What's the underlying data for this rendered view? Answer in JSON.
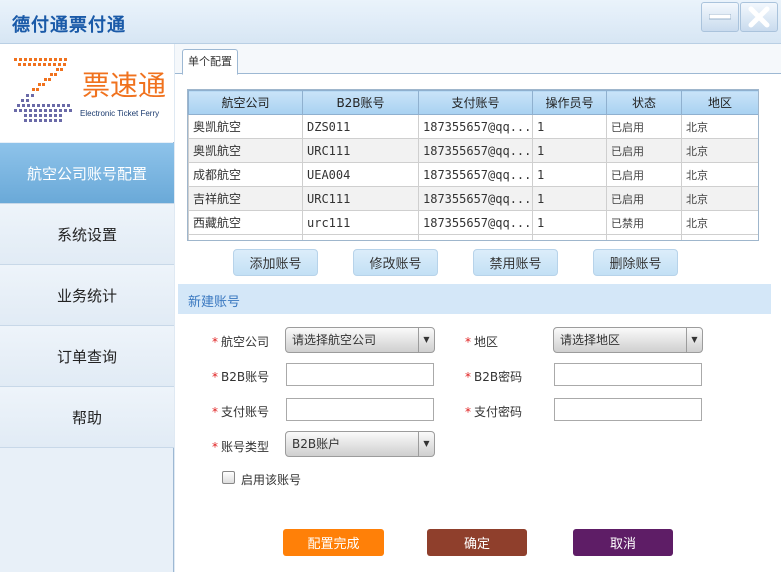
{
  "app": {
    "title": "德付通票付通"
  },
  "logo": {
    "name": "票速通",
    "sub": "Electronic Ticket Ferry"
  },
  "sidebar": {
    "items": [
      {
        "label": "航空公司账号配置",
        "active": true
      },
      {
        "label": "系统设置"
      },
      {
        "label": "业务统计"
      },
      {
        "label": "订单查询"
      },
      {
        "label": "帮助"
      }
    ]
  },
  "tabs": [
    {
      "label": "单个配置"
    }
  ],
  "table": {
    "headers": [
      "航空公司",
      "B2B账号",
      "支付账号",
      "操作员号",
      "状态",
      "地区"
    ],
    "rows": [
      [
        "奥凯航空",
        "DZS011",
        "187355657@qq...",
        "1",
        "已启用",
        "北京"
      ],
      [
        "奥凯航空",
        "URC111",
        "187355657@qq...",
        "1",
        "已启用",
        "北京"
      ],
      [
        "成都航空",
        "UEA004",
        "187355657@qq...",
        "1",
        "已启用",
        "北京"
      ],
      [
        "吉祥航空",
        "URC111",
        "187355657@qq...",
        "1",
        "已启用",
        "北京"
      ],
      [
        "西藏航空",
        "urc111",
        "187355657@qq...",
        "1",
        "已禁用",
        "北京"
      ]
    ]
  },
  "actions": {
    "add": "添加账号",
    "edit": "修改账号",
    "disable": "禁用账号",
    "delete": "删除账号"
  },
  "form": {
    "section_title": "新建账号",
    "airline_label": "航空公司",
    "airline_value": "请选择航空公司",
    "region_label": "地区",
    "region_value": "请选择地区",
    "b2b_account_label": "B2B账号",
    "b2b_password_label": "B2B密码",
    "pay_account_label": "支付账号",
    "pay_password_label": "支付密码",
    "type_label": "账号类型",
    "type_value": "B2B账户",
    "enable_label": "启用该账号"
  },
  "buttons": {
    "configure": "配置完成",
    "confirm": "确定",
    "cancel": "取消"
  },
  "colors": {
    "configure": "#ff8008",
    "confirm": "#8f3f2c",
    "cancel": "#5e1d66",
    "active_nav": "#7ab6e0"
  }
}
